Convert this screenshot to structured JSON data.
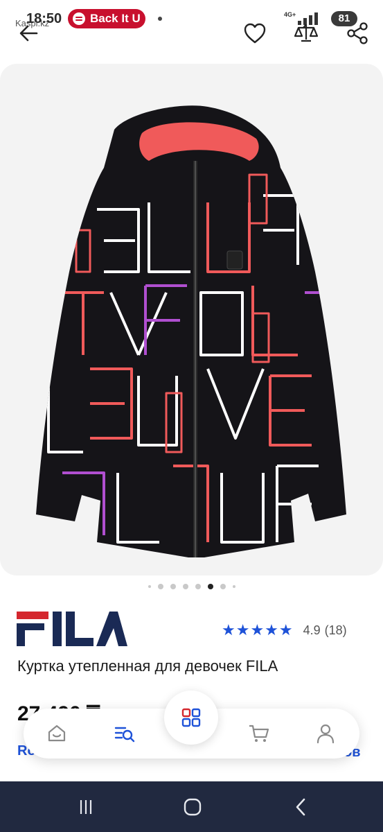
{
  "status_bar": {
    "time": "18:50",
    "app_label": "Kaspi.kz",
    "media_pill": "Back It U",
    "network": "4G+",
    "battery": "81"
  },
  "top_nav": {
    "back_icon": "arrow-left-icon",
    "favorite_icon": "heart-icon",
    "compare_icon": "scales-icon",
    "share_icon": "share-icon"
  },
  "gallery": {
    "image": "product-photo",
    "dots_total": 8,
    "active_index": 5
  },
  "product": {
    "brand": "FILA",
    "rating_stars": "★★★★★",
    "rating_value": "4.9",
    "rating_count": "(18)",
    "title": "Куртка утепленная для девочек FILA",
    "price_partial": "27 490 ₸",
    "link_left_partial": "Ro",
    "link_right_partial": "ов"
  },
  "tab_bar": {
    "items": [
      {
        "icon": "home-icon"
      },
      {
        "icon": "catalog-search-icon"
      },
      {
        "icon": "services-grid-icon"
      },
      {
        "icon": "cart-icon"
      },
      {
        "icon": "profile-icon"
      }
    ]
  },
  "colors": {
    "accent_blue": "#1e52d8",
    "fila_navy": "#1a2a55",
    "fila_red": "#d4272e",
    "spotify_pill": "#c8102e",
    "system_nav": "#212940"
  }
}
